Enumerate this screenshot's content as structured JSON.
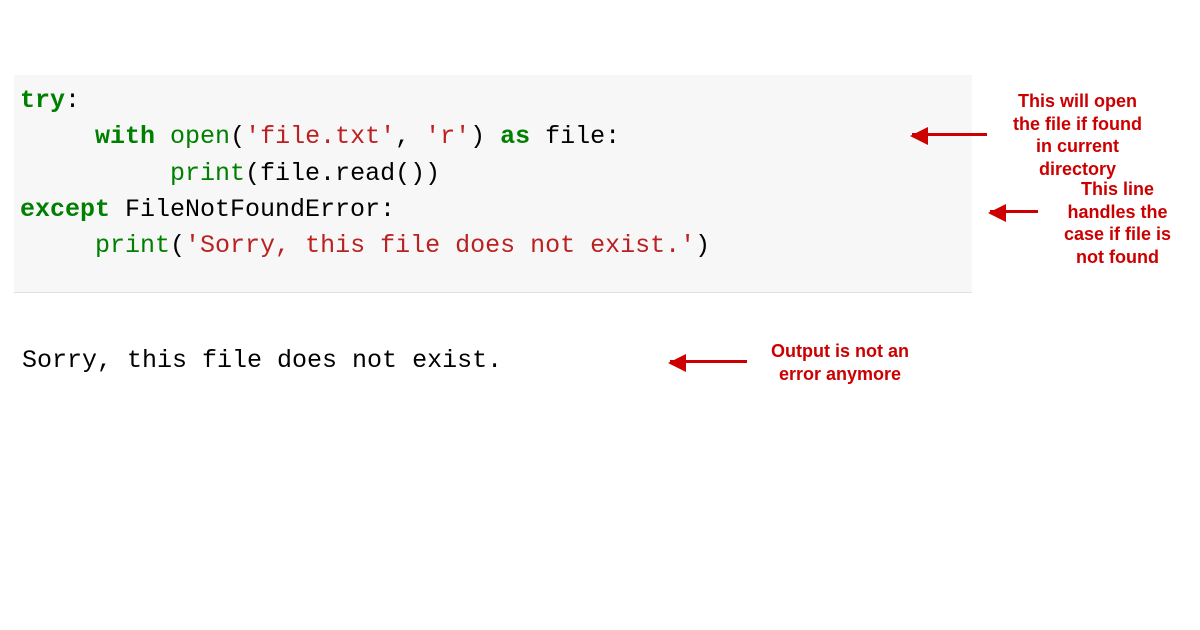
{
  "code": {
    "l1": {
      "kw1": "try",
      "colon": ":"
    },
    "l2": {
      "ind": "     ",
      "kw1": "with",
      "sp1": " ",
      "fn": "open",
      "paren1": "(",
      "str1": "'file.txt'",
      "comma": ", ",
      "str2": "'r'",
      "paren2": ") ",
      "kw2": "as",
      "sp2": " file:"
    },
    "l3": {
      "ind": "          ",
      "fn": "print",
      "text": "(file.read())"
    },
    "l4": {
      "kw1": "except",
      "text": " FileNotFoundError:"
    },
    "l5": {
      "ind": "     ",
      "fn": "print",
      "paren1": "(",
      "str1": "'Sorry, this file does not exist.'",
      "paren2": ")"
    }
  },
  "output": "Sorry, this file does not exist.",
  "annotations": {
    "a1": "This will open\nthe file if found\nin current\ndirectory",
    "a2": "This line\nhandles the\ncase if file is\nnot found",
    "a3": "Output is not an\nerror anymore"
  }
}
